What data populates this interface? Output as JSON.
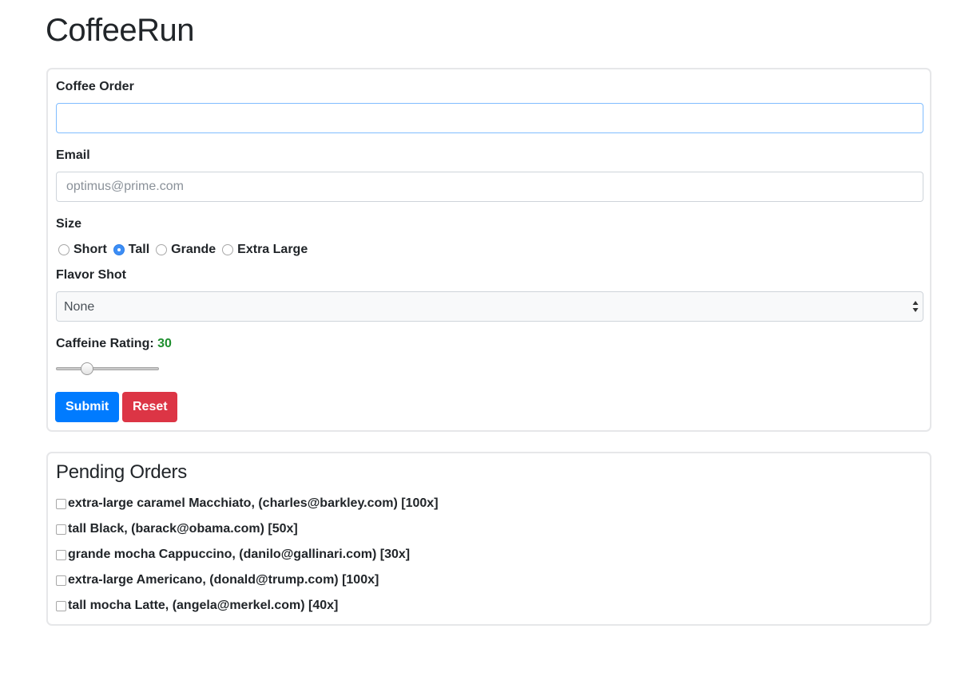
{
  "app": {
    "title": "CoffeeRun"
  },
  "form": {
    "coffee_order": {
      "label": "Coffee Order",
      "value": "",
      "placeholder": ""
    },
    "email": {
      "label": "Email",
      "value": "",
      "placeholder": "optimus@prime.com"
    },
    "size": {
      "label": "Size",
      "options": [
        {
          "label": "Short",
          "checked": false
        },
        {
          "label": "Tall",
          "checked": true
        },
        {
          "label": "Grande",
          "checked": false
        },
        {
          "label": "Extra Large",
          "checked": false
        }
      ]
    },
    "flavor_shot": {
      "label": "Flavor Shot",
      "selected": "None"
    },
    "caffeine_rating": {
      "label": "Caffeine Rating:",
      "value": "30",
      "slider_fraction": 0.3
    },
    "submit_label": "Submit",
    "reset_label": "Reset"
  },
  "colors": {
    "primary": "#007bff",
    "danger": "#dc3545",
    "rating_text": "#1e8f2e",
    "radio_checked": "#3d8ef5"
  },
  "pending": {
    "title": "Pending Orders",
    "orders": [
      {
        "text": "extra-large caramel Macchiato, (charles@barkley.com) [100x]"
      },
      {
        "text": "tall Black, (barack@obama.com) [50x]"
      },
      {
        "text": "grande mocha Cappuccino, (danilo@gallinari.com) [30x]"
      },
      {
        "text": "extra-large Americano, (donald@trump.com) [100x]"
      },
      {
        "text": "tall mocha Latte, (angela@merkel.com) [40x]"
      }
    ]
  }
}
